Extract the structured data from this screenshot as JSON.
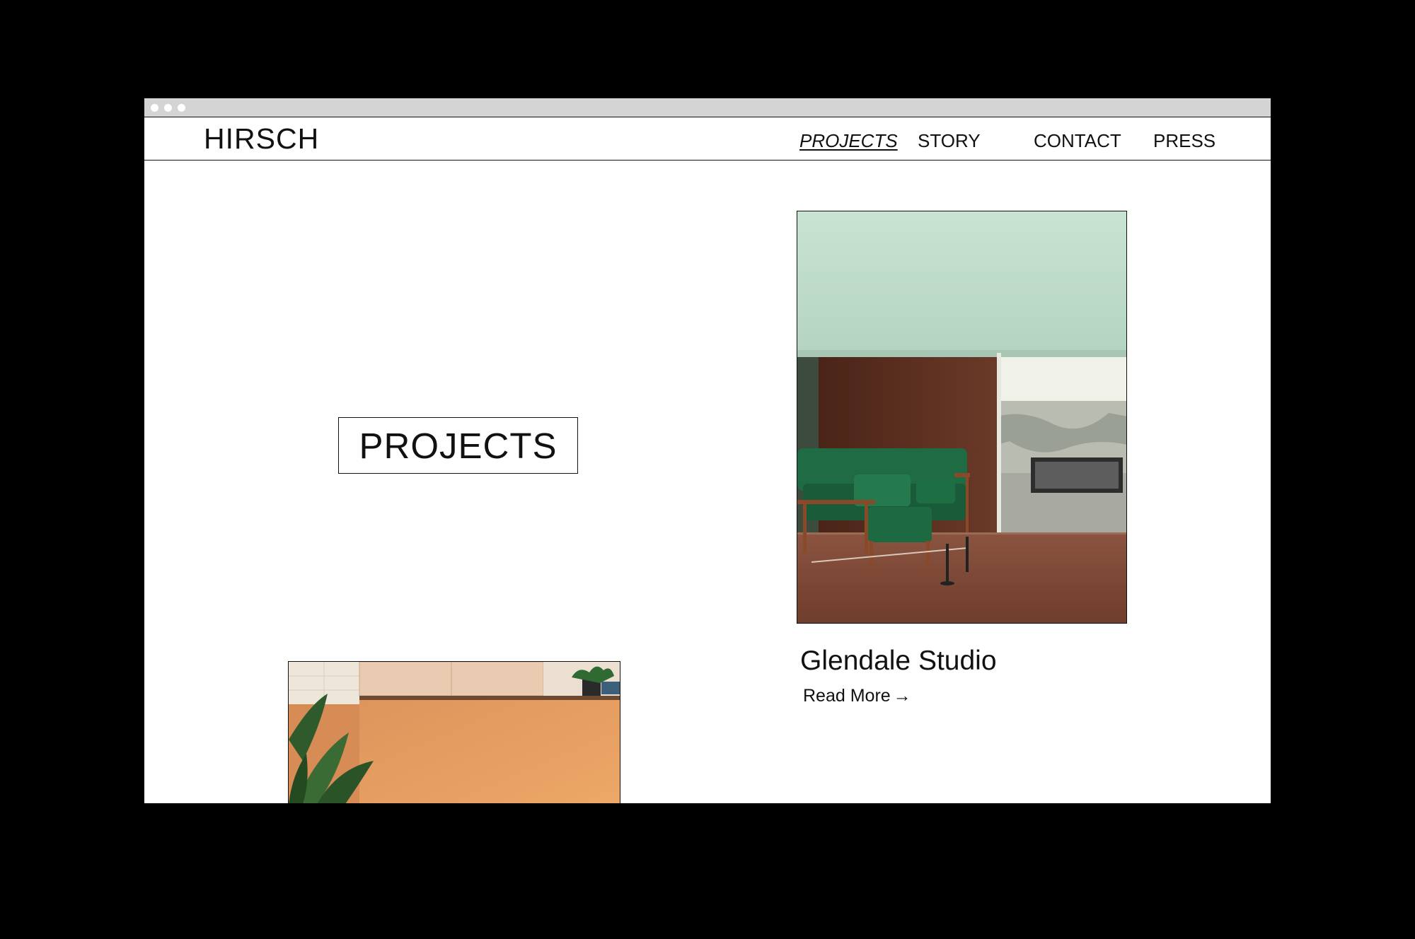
{
  "site": {
    "logo": "HIRSCH",
    "nav": [
      {
        "label": "PROJECTS",
        "active": true
      },
      {
        "label": "STORY",
        "active": false
      },
      {
        "label": "CONTACT",
        "active": false
      },
      {
        "label": "PRESS",
        "active": false
      }
    ]
  },
  "main": {
    "section_title": "PROJECTS",
    "project": {
      "title": "Glendale Studio",
      "link_label": "Read More",
      "link_icon": "arrow-right-icon"
    }
  },
  "colors": {
    "page_background": "#ffffff",
    "text": "#111111",
    "outer_background": "#000000",
    "chrome_bar": "#d4d4d4"
  }
}
